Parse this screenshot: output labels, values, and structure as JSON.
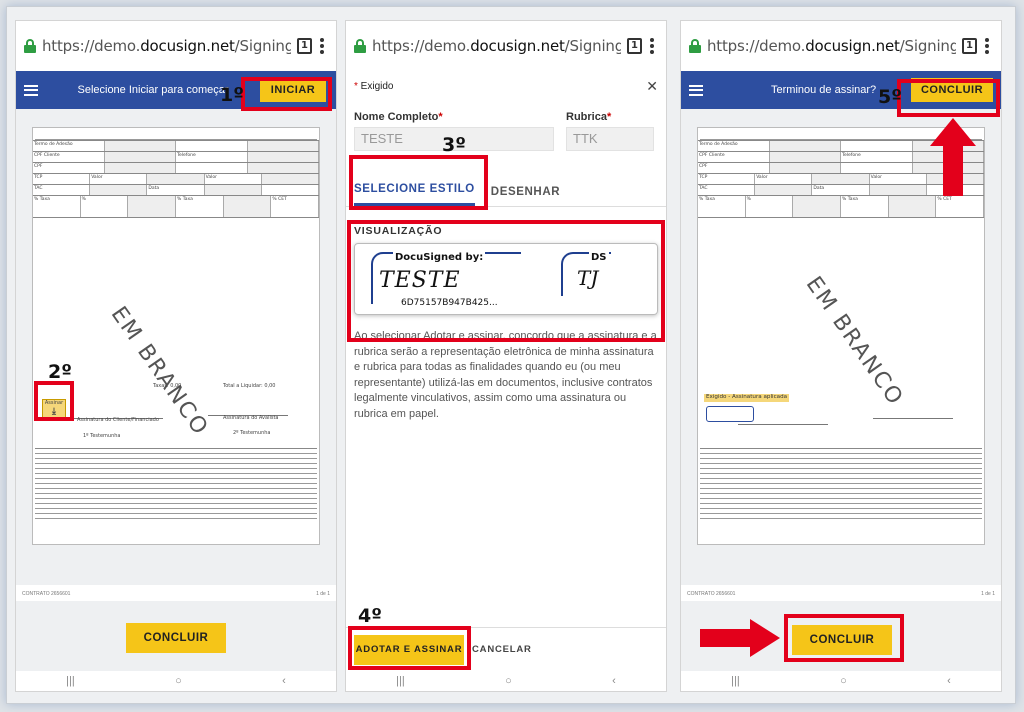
{
  "browser": {
    "url_prefix": "https://demo.",
    "url_domain": "docusign.net",
    "url_path": "/Signing/?",
    "tab_count": "1"
  },
  "panel1": {
    "header_message": "Selecione Iniciar para começar",
    "start_button": "INICIAR",
    "watermark": "EM BRANCO",
    "download_label": "Assinar",
    "total_label": "Total a Liquidar:",
    "total_value": "0,00",
    "taxes_label": "Taxas:",
    "taxes_value": "0,00",
    "sign_client": "Assinatura do Cliente/Financiado",
    "sign_witness": "Assinatura do Avalista",
    "witness1": "1º Testemunha",
    "witness2": "2º Testemunha",
    "contract": "CONTRATO 2656601",
    "page": "1 de 1",
    "conclude_button": "CONCLUIR"
  },
  "panel2": {
    "required_label": "Exigido",
    "full_name_label": "Nome Completo",
    "full_name_value": "TESTE",
    "initials_label": "Rubrica",
    "initials_value": "TTK",
    "tab_style": "SELECIONE ESTILO",
    "tab_draw": "DESENHAR",
    "preview_title": "VISUALIZAÇÃO",
    "docusigned_by": "DocuSigned by:",
    "sig_name": "TESTE",
    "sig_id": "6D75157B947B425...",
    "ds_label": "DS",
    "initials_sig": "TJ",
    "disclaimer": "Ao selecionar Adotar e assinar, concordo que a assinatura e a rubrica serão a representação eletrônica de minha assinatura e rubrica para todas as finalidades quando eu (ou meu representante) utilizá-las em documentos, inclusive contratos legalmente vinculativos, assim como uma assinatura ou rubrica em papel.",
    "adopt_button": "ADOTAR E ASSINAR",
    "cancel_button": "CANCELAR"
  },
  "panel3": {
    "header_message": "Terminou de assinar?",
    "conclude_top": "CONCLUIR",
    "watermark": "EM BRANCO",
    "applied_label": "Exigido - Assinatura aplicada",
    "contract": "CONTRATO 2656601",
    "page": "1 de 1",
    "conclude_button": "CONCLUIR"
  },
  "steps": {
    "s1": "1º",
    "s2": "2º",
    "s3": "3º",
    "s4": "4º",
    "s5": "5º"
  },
  "nav": {
    "recent": "|||",
    "home": "○",
    "back": "‹"
  },
  "colors": {
    "brand_blue": "#2d4ea0",
    "button_yellow": "#f5c518",
    "highlight_red": "#e3001b"
  }
}
